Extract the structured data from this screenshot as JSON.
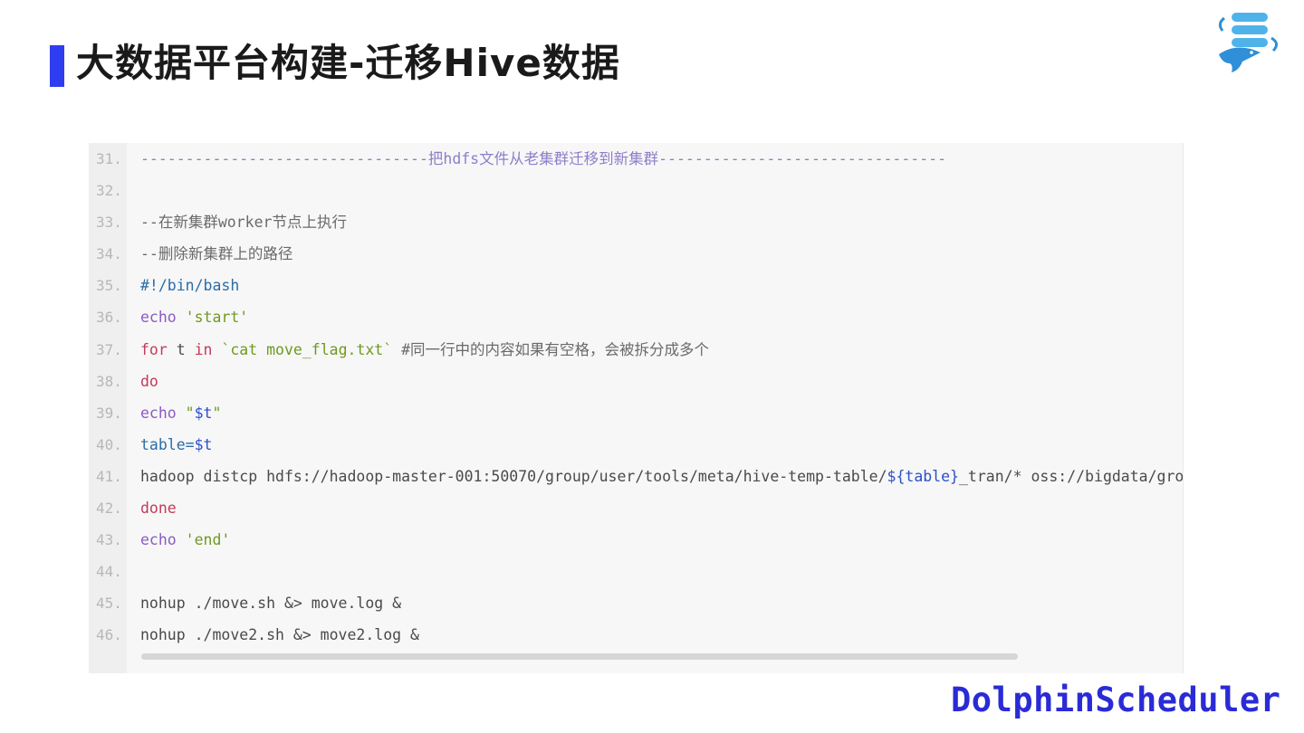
{
  "slide": {
    "title": "大数据平台构建-迁移Hive数据",
    "brand": "DolphinScheduler",
    "logo_icon": "dolphin-database-logo",
    "colors": {
      "accent": "#2f3df0",
      "brand": "#2a2bd6"
    }
  },
  "code": {
    "lines": [
      {
        "num": "31.",
        "tokens": [
          {
            "t": "--------------------------------把hdfs文件从老集群迁移到新集群--------------------------------",
            "c": "c-dash"
          }
        ]
      },
      {
        "num": "32.",
        "tokens": []
      },
      {
        "num": "33.",
        "tokens": [
          {
            "t": "--在新集群worker节点上执行",
            "c": "c-comment"
          }
        ]
      },
      {
        "num": "34.",
        "tokens": [
          {
            "t": "--删除新集群上的路径",
            "c": "c-comment"
          }
        ]
      },
      {
        "num": "35.",
        "tokens": [
          {
            "t": "#!/bin/bash",
            "c": "c-shebang"
          }
        ]
      },
      {
        "num": "36.",
        "tokens": [
          {
            "t": "echo ",
            "c": "c-echo"
          },
          {
            "t": "'start'",
            "c": "c-str"
          }
        ]
      },
      {
        "num": "37.",
        "tokens": [
          {
            "t": "for",
            "c": "c-kw"
          },
          {
            "t": " t ",
            "c": "c-plain"
          },
          {
            "t": "in",
            "c": "c-kw"
          },
          {
            "t": " `cat move_flag.txt`",
            "c": "c-str"
          },
          {
            "t": " #同一行中的内容如果有空格，会被拆分成多个",
            "c": "c-comment"
          }
        ]
      },
      {
        "num": "38.",
        "tokens": [
          {
            "t": "do",
            "c": "c-kw"
          }
        ]
      },
      {
        "num": "39.",
        "tokens": [
          {
            "t": "echo ",
            "c": "c-echo"
          },
          {
            "t": "\"",
            "c": "c-str"
          },
          {
            "t": "$t",
            "c": "c-var"
          },
          {
            "t": "\"",
            "c": "c-str"
          }
        ]
      },
      {
        "num": "40.",
        "tokens": [
          {
            "t": "table=",
            "c": "c-shebang"
          },
          {
            "t": "$t",
            "c": "c-var"
          }
        ]
      },
      {
        "num": "41.",
        "tokens": [
          {
            "t": "hadoop distcp hdfs://hadoop-master-001:50070/group/user/tools/meta/hive-temp-table/",
            "c": "c-plain"
          },
          {
            "t": "${table}",
            "c": "c-var"
          },
          {
            "t": "_tran/* oss://bigdata/group/user/tools/meta/",
            "c": "c-plain"
          }
        ]
      },
      {
        "num": "42.",
        "tokens": [
          {
            "t": "done",
            "c": "c-kw"
          }
        ]
      },
      {
        "num": "43.",
        "tokens": [
          {
            "t": "echo ",
            "c": "c-echo"
          },
          {
            "t": "'end'",
            "c": "c-str"
          }
        ]
      },
      {
        "num": "44.",
        "tokens": []
      },
      {
        "num": "45.",
        "tokens": [
          {
            "t": "nohup ./move.sh &> move.log &",
            "c": "c-plain"
          }
        ]
      },
      {
        "num": "46.",
        "tokens": [
          {
            "t": "nohup ./move2.sh &> move2.log &",
            "c": "c-plain"
          }
        ]
      }
    ]
  }
}
